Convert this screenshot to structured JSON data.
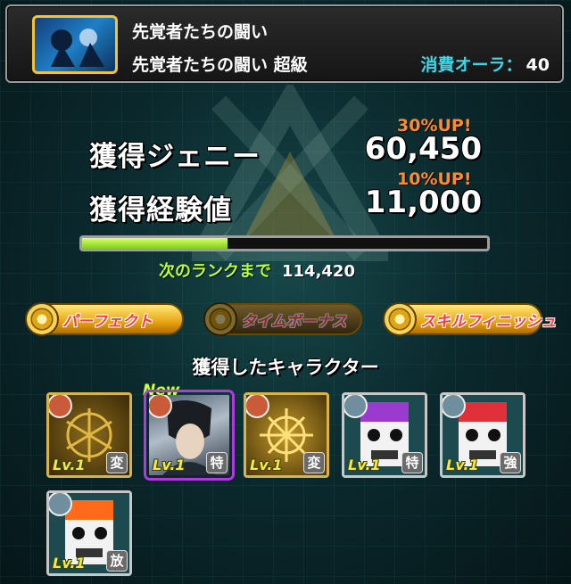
{
  "header": {
    "quest_title": "先覚者たちの闘い",
    "quest_difficulty": "先覚者たちの闘い 超級",
    "aura_label": "消費オーラ：",
    "aura_value": "40"
  },
  "rewards": {
    "zenny_bonus": "30%UP!",
    "zenny_label": "獲得ジェニー",
    "zenny_value": "60,450",
    "exp_bonus": "10%UP!",
    "exp_label": "獲得経験値",
    "exp_value": "11,000",
    "rank_progress": 0.36,
    "next_rank_label": "次のランクまで",
    "next_rank_value": "114,420"
  },
  "badges": [
    {
      "label": "パーフェクト",
      "active": true
    },
    {
      "label": "タイムボーナス",
      "active": false
    },
    {
      "label": "スキルフィニッシュ",
      "active": true
    }
  ],
  "characters_title": "獲得したキャラクター",
  "characters": [
    {
      "level": "Lv.1",
      "type": "変",
      "is_new": false,
      "element_color": "#c95a3a",
      "art": "gold-card"
    },
    {
      "level": "Lv.1",
      "type": "特",
      "is_new": true,
      "new_label": "New",
      "element_color": "#c95a3a",
      "art": "portrait"
    },
    {
      "level": "Lv.1",
      "type": "変",
      "is_new": false,
      "element_color": "#c95a3a",
      "art": "gold-card"
    },
    {
      "level": "Lv.1",
      "type": "特",
      "is_new": false,
      "element_color": "#6f8f9f",
      "art": "purple-robot"
    },
    {
      "level": "Lv.1",
      "type": "強",
      "is_new": false,
      "element_color": "#6f8f9f",
      "art": "red-robot"
    },
    {
      "level": "Lv.1",
      "type": "放",
      "is_new": false,
      "element_color": "#6f8f9f",
      "art": "orange-robot"
    }
  ]
}
